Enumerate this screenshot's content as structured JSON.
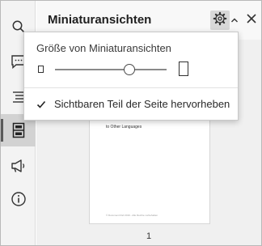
{
  "panel": {
    "title": "Miniaturansichten",
    "page_number": "1"
  },
  "rail": {
    "items": [
      {
        "icon": "search-icon"
      },
      {
        "icon": "comment-icon"
      },
      {
        "icon": "list-icon"
      },
      {
        "icon": "thumbnails-icon",
        "active": true
      },
      {
        "icon": "megaphone-icon"
      },
      {
        "icon": "info-icon"
      }
    ]
  },
  "header_controls": {
    "gear_icon": "gear-icon",
    "caret_icon": "chevron-up-icon",
    "close_icon": "close-icon"
  },
  "popup": {
    "size_label": "Größe von Miniaturansichten",
    "size_value": 0.67,
    "option_label": "Sichtbaren Teil der Seite hervorheben",
    "option_checked": true
  },
  "thumbnail_page": {
    "heading_text": "to Other Languages",
    "footer_text": "© Document Ref 2019 - Alle Rechte vorbehalten"
  },
  "colors": {
    "rail_background": "#f3f3f3",
    "active_rail_item": "#d2d2d2",
    "panel_background": "#f0f0f0",
    "gear_button_background": "#d8d8d8"
  }
}
